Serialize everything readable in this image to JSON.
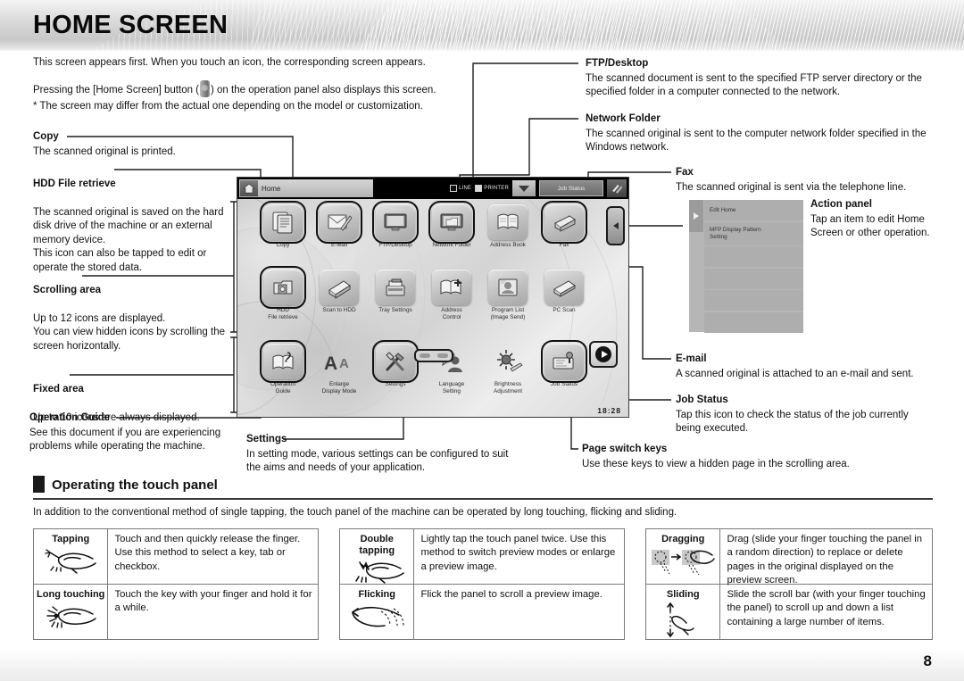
{
  "header": {
    "title": "HOME SCREEN",
    "page_number": "8"
  },
  "intro": {
    "line1": "This screen appears first. When you touch an icon, the corresponding screen appears.",
    "line2_a": "Pressing the [Home Screen] button (",
    "line2_b": ") on the operation panel also displays this screen.",
    "line3": "* The screen may differ from the actual one depending on the model or customization."
  },
  "annotations": {
    "copy": {
      "heading": "Copy",
      "body": "The scanned original is printed."
    },
    "hdd_file_retrieve": {
      "heading": "HDD File retrieve",
      "body": "The scanned original is saved on the hard disk drive of the machine or an external memory device.\nThis icon can also be tapped to edit or operate the stored data."
    },
    "scrolling_area": {
      "heading": "Scrolling area",
      "body": "Up to 12 icons are displayed.\nYou can view hidden icons by scrolling the screen horizontally."
    },
    "fixed_area": {
      "heading": "Fixed area",
      "body": "Up to 10 icons are always displayed."
    },
    "operation_guide": {
      "heading": "Operation Guide",
      "body": "See this document if you are experiencing problems while operating the machine."
    },
    "settings": {
      "heading": "Settings",
      "body": "In setting mode, various settings can be configured to suit the aims and needs of your application."
    },
    "ftp_desktop": {
      "heading": "FTP/Desktop",
      "body": "The scanned document is sent to the specified FTP server directory or the specified folder in a computer connected to the network."
    },
    "network_folder": {
      "heading": "Network Folder",
      "body": "The scanned original is sent to the computer network folder specified in the Windows network."
    },
    "fax": {
      "heading": "Fax",
      "body": "The scanned original is sent via the telephone line."
    },
    "action_panel": {
      "heading": "Action panel",
      "body": "Tap an item to edit Home Screen or other operation."
    },
    "email": {
      "heading": "E-mail",
      "body": "A scanned original is attached to an e-mail and sent."
    },
    "job_status": {
      "heading": "Job Status",
      "body": "Tap this icon to check the status of the job currently being executed."
    },
    "page_switch_keys": {
      "heading": "Page switch keys",
      "body": "Use these keys to view a hidden page in the scrolling area."
    }
  },
  "touch_panel": {
    "home_tab_label": "Home",
    "status_line": "LINE",
    "status_printer": "PRINTER",
    "job_status_button": "Job Status",
    "clock": "18:28",
    "row1": [
      {
        "label": "Copy",
        "icon": "copy-icon",
        "selected": true
      },
      {
        "label": "E-Mail",
        "icon": "email-icon",
        "selected": true
      },
      {
        "label": "FTP/Desktop",
        "icon": "ftp-desktop-icon",
        "selected": true
      },
      {
        "label": "Network Folder",
        "icon": "network-folder-icon",
        "selected": true
      },
      {
        "label": "Address Book",
        "icon": "address-book-icon",
        "selected": false
      },
      {
        "label": "Fax",
        "icon": "fax-icon",
        "selected": true
      }
    ],
    "row2": [
      {
        "label": "HDD\nFile retrieve",
        "icon": "hdd-file-retrieve-icon",
        "selected": true
      },
      {
        "label": "Scan to HDD",
        "icon": "scan-to-hdd-icon",
        "selected": false
      },
      {
        "label": "Tray Settings",
        "icon": "tray-settings-icon",
        "selected": false
      },
      {
        "label": "Address\nControl",
        "icon": "address-control-icon",
        "selected": false
      },
      {
        "label": "Program List\n(Image Send)",
        "icon": "program-list-icon",
        "selected": false
      },
      {
        "label": "PC Scan",
        "icon": "pc-scan-icon",
        "selected": false
      }
    ],
    "row3": [
      {
        "label": "Operation\nGuide",
        "icon": "operation-guide-icon",
        "selected": true
      },
      {
        "label": "Enlarge\nDisplay Mode",
        "icon": "enlarge-display-mode-icon",
        "selected": false
      },
      {
        "label": "Settings",
        "icon": "settings-icon",
        "selected": true
      },
      {
        "label": "Language\nSetting",
        "icon": "language-setting-icon",
        "selected": false
      },
      {
        "label": "Brightness\nAdjustment",
        "icon": "brightness-adjustment-icon",
        "selected": false
      },
      {
        "label": "Job Status",
        "icon": "job-status-icon",
        "selected": true
      }
    ]
  },
  "action_panel_mock": {
    "items": [
      "Edit Home",
      "MFP Display Pattern\nSetting",
      "",
      "",
      "",
      ""
    ]
  },
  "touch_section": {
    "heading": "Operating the touch panel",
    "intro": "In addition to the conventional method of single tapping, the touch panel of the machine can be operated by long touching, flicking and sliding.",
    "gestures": [
      {
        "name": "Tapping",
        "icon": "tap-hand-icon",
        "desc": "Touch and then quickly release the finger. Use this method to select a key, tab or checkbox."
      },
      {
        "name": "Long touching",
        "icon": "long-touch-hand-icon",
        "desc": "Touch the key with your finger and hold it for a while."
      },
      {
        "name": "Double\ntapping",
        "icon": "double-tap-hand-icon",
        "desc": "Lightly tap the touch panel twice. Use this method to switch preview modes or enlarge a preview image."
      },
      {
        "name": "Flicking",
        "icon": "flick-hand-icon",
        "desc": "Flick the panel to scroll a preview image."
      },
      {
        "name": "Dragging",
        "icon": "drag-hand-icon",
        "desc": "Drag (slide your finger touching the panel in a random direction) to replace or delete pages in the original displayed on the preview screen."
      },
      {
        "name": "Sliding",
        "icon": "slide-hand-icon",
        "desc": "Slide the scroll bar (with your finger touching the panel) to scroll up and down a list containing a large number of items."
      }
    ]
  }
}
